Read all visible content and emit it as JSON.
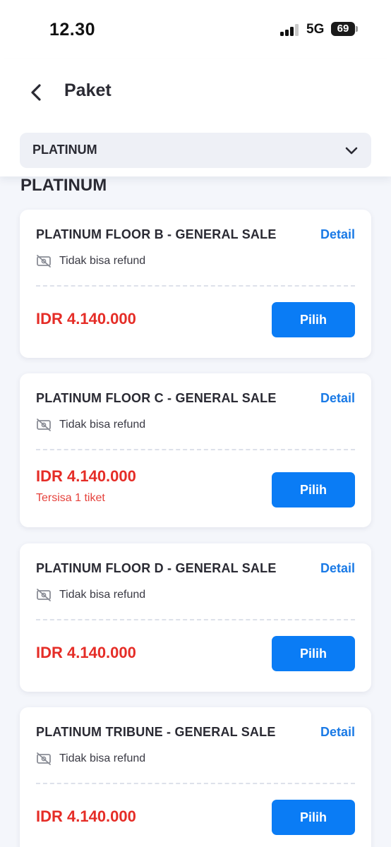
{
  "status": {
    "time": "12.30",
    "network": "5G",
    "battery": "69",
    "signal_bars_filled": 3,
    "signal_bars_total": 4
  },
  "header": {
    "title": "Paket",
    "back_icon": "chevron-left-icon"
  },
  "filter": {
    "selected": "PLATINUM",
    "chevron_icon": "chevron-down-icon"
  },
  "section": {
    "title": "PLATINUM"
  },
  "packages": [
    {
      "name": "PLATINUM FLOOR B - GENERAL SALE",
      "detail_label": "Detail",
      "refund_text": "Tidak bisa refund",
      "refund_icon": "no-refund-icon",
      "price": "IDR 4.140.000",
      "remaining": "",
      "button_label": "Pilih"
    },
    {
      "name": "PLATINUM FLOOR C - GENERAL SALE",
      "detail_label": "Detail",
      "refund_text": "Tidak bisa refund",
      "refund_icon": "no-refund-icon",
      "price": "IDR 4.140.000",
      "remaining": "Tersisa 1 tiket",
      "button_label": "Pilih"
    },
    {
      "name": "PLATINUM FLOOR D - GENERAL SALE",
      "detail_label": "Detail",
      "refund_text": "Tidak bisa refund",
      "refund_icon": "no-refund-icon",
      "price": "IDR 4.140.000",
      "remaining": "",
      "button_label": "Pilih"
    },
    {
      "name": "PLATINUM TRIBUNE - GENERAL SALE",
      "detail_label": "Detail",
      "refund_text": "Tidak bisa refund",
      "refund_icon": "no-refund-icon",
      "price": "IDR 4.140.000",
      "remaining": "",
      "button_label": "Pilih"
    }
  ],
  "colors": {
    "accent": "#0a7cf5",
    "link": "#1a7ae6",
    "price": "#e52d27",
    "background": "#f4f6fb"
  }
}
